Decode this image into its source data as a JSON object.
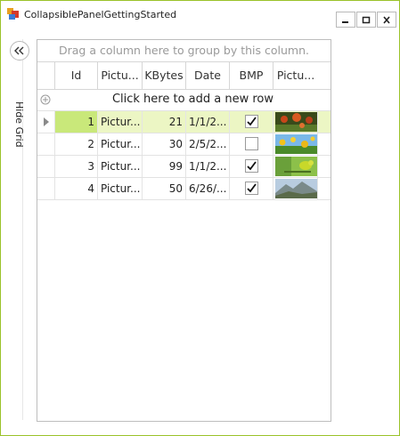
{
  "window": {
    "title": "CollapsiblePanelGettingStarted",
    "border_color": "#9ac229",
    "controls": [
      "minimize-icon",
      "maximize-icon",
      "close-icon"
    ]
  },
  "collapsible_panel": {
    "toggle_icon": "double-chevron-left-icon",
    "label": "Hide Grid"
  },
  "grid": {
    "group_panel_text": "Drag a column here to group by this column.",
    "columns": [
      "Id",
      "Pictu...",
      "KBytes",
      "Date",
      "BMP",
      "Pictu..."
    ],
    "new_row_text": "Click here to add a new row",
    "new_row_icon": "plus-circle-icon",
    "selected_color": "#c9e87a",
    "rows": [
      {
        "id": "1",
        "picture": "Pictur...",
        "kbytes": "21",
        "date": "1/1/2...",
        "bmp": true,
        "thumb": "red-flowers-photo"
      },
      {
        "id": "2",
        "picture": "Pictur...",
        "kbytes": "30",
        "date": "2/5/2...",
        "bmp": false,
        "thumb": "yellow-flowers-photo"
      },
      {
        "id": "3",
        "picture": "Pictur...",
        "kbytes": "99",
        "date": "1/1/2...",
        "bmp": true,
        "thumb": "green-bird-photo"
      },
      {
        "id": "4",
        "picture": "Pictur...",
        "kbytes": "50",
        "date": "6/26/...",
        "bmp": true,
        "thumb": "mountain-photo"
      }
    ]
  }
}
